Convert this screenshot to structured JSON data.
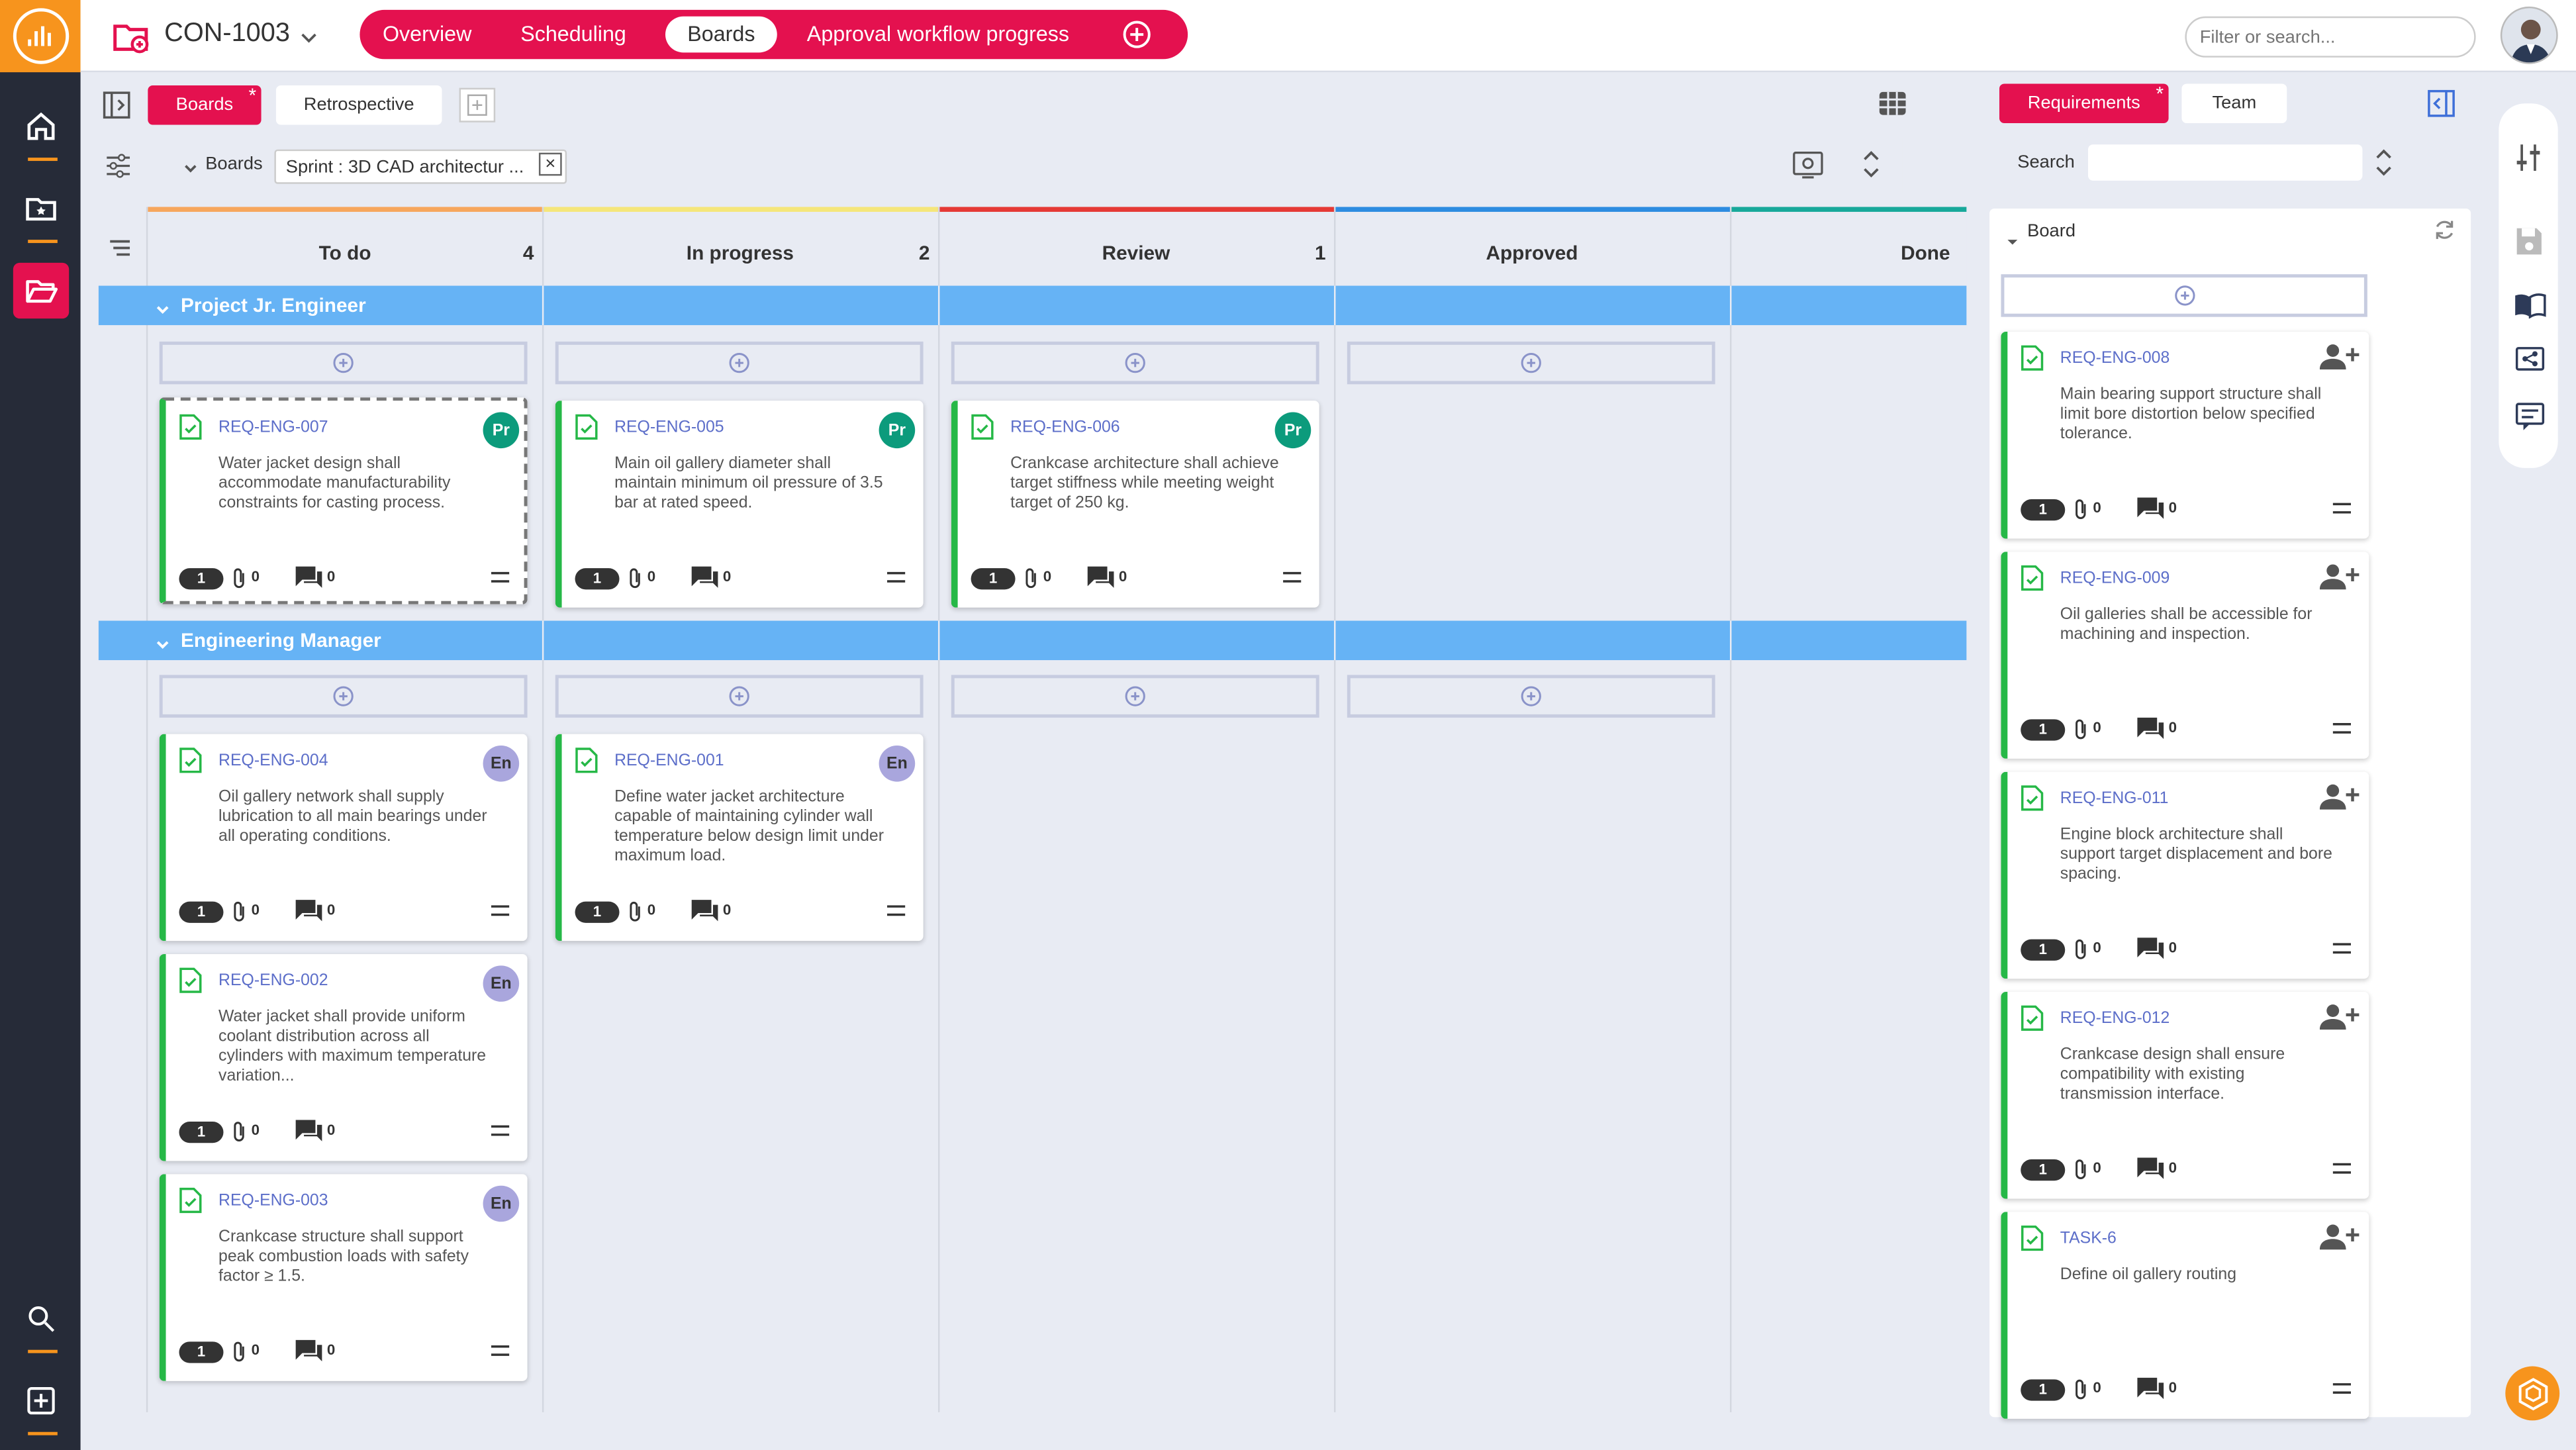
{
  "colors": {
    "accent": "#e4114f",
    "brand": "#f7941d",
    "rail": "#262b38",
    "swimlane": "#66b3f5",
    "card_border": "#26b847",
    "badge_pr": "#0c9b7c",
    "badge_en": "#a9a6dd"
  },
  "header": {
    "project": "CON-1003",
    "tabs": [
      "Overview",
      "Scheduling",
      "Boards",
      "Approval workflow progress"
    ],
    "active_tab": "Boards",
    "search_placeholder": "Filter or search..."
  },
  "subtabs": {
    "boards": "Boards",
    "retro": "Retrospective",
    "requirements": "Requirements",
    "team": "Team",
    "star": "*"
  },
  "filter": {
    "label": "Boards",
    "chip": "Sprint : 3D CAD architectur ...",
    "remove": "×"
  },
  "columns": [
    {
      "title": "To do",
      "count": "4",
      "color": "#f7a65c"
    },
    {
      "title": "In progress",
      "count": "2",
      "color": "#f5e67a"
    },
    {
      "title": "Review",
      "count": "1",
      "color": "#e53935"
    },
    {
      "title": "Approved",
      "count": "",
      "color": "#2d8ce0"
    },
    {
      "title": "Done",
      "count": "",
      "color": "#17a89a"
    }
  ],
  "swimlanes": [
    "Project Jr. Engineer",
    "Engineering Manager"
  ],
  "cards": [
    {
      "id": "REQ-ENG-007",
      "desc": "Water jacket design shall accommodate manufacturability constraints for casting process.",
      "badge": "Pr",
      "points": "1",
      "clips": "0",
      "comments": "0"
    },
    {
      "id": "REQ-ENG-005",
      "desc": "Main oil gallery diameter shall maintain minimum oil pressure of 3.5 bar at rated speed.",
      "badge": "Pr",
      "points": "1",
      "clips": "0",
      "comments": "0"
    },
    {
      "id": "REQ-ENG-006",
      "desc": "Crankcase architecture shall achieve target stiffness while meeting weight target of 250 kg.",
      "badge": "Pr",
      "points": "1",
      "clips": "0",
      "comments": "0"
    },
    {
      "id": "REQ-ENG-004",
      "desc": "Oil gallery network shall supply lubrication to all main bearings under all operating conditions.",
      "badge": "En",
      "points": "1",
      "clips": "0",
      "comments": "0"
    },
    {
      "id": "REQ-ENG-001",
      "desc": "Define water jacket architecture capable of maintaining cylinder wall temperature below design limit under maximum load.",
      "badge": "En",
      "points": "1",
      "clips": "0",
      "comments": "0"
    },
    {
      "id": "REQ-ENG-002",
      "desc": "Water jacket shall provide uniform coolant distribution across all cylinders with maximum temperature variation...",
      "badge": "En",
      "points": "1",
      "clips": "0",
      "comments": "0"
    },
    {
      "id": "REQ-ENG-003",
      "desc": "Crankcase structure shall support peak combustion loads with safety factor ≥ 1.5.",
      "badge": "En",
      "points": "1",
      "clips": "0",
      "comments": "0"
    }
  ],
  "right_panel": {
    "search_label": "Search",
    "board_label": "Board",
    "items": [
      {
        "id": "REQ-ENG-008",
        "desc": "Main bearing support structure shall limit bore distortion below specified tolerance.",
        "points": "1",
        "clips": "0",
        "comments": "0"
      },
      {
        "id": "REQ-ENG-009",
        "desc": "Oil galleries shall be accessible for machining and inspection.",
        "points": "1",
        "clips": "0",
        "comments": "0"
      },
      {
        "id": "REQ-ENG-011",
        "desc": "Engine block architecture shall support target displacement and bore spacing.",
        "points": "1",
        "clips": "0",
        "comments": "0"
      },
      {
        "id": "REQ-ENG-012",
        "desc": "Crankcase design shall ensure compatibility with existing transmission interface.",
        "points": "1",
        "clips": "0",
        "comments": "0"
      },
      {
        "id": "TASK-6",
        "desc": "Define oil gallery routing",
        "points": "1",
        "clips": "0",
        "comments": "0"
      }
    ]
  },
  "icons": {
    "left_rail": [
      "logo-icon",
      "home-icon",
      "starred-folder-icon",
      "open-folder-icon",
      "search-icon",
      "add-box-icon"
    ],
    "right_rail": [
      "tune-icon",
      "save-icon",
      "book-icon",
      "share-icon",
      "comment-icon"
    ]
  }
}
